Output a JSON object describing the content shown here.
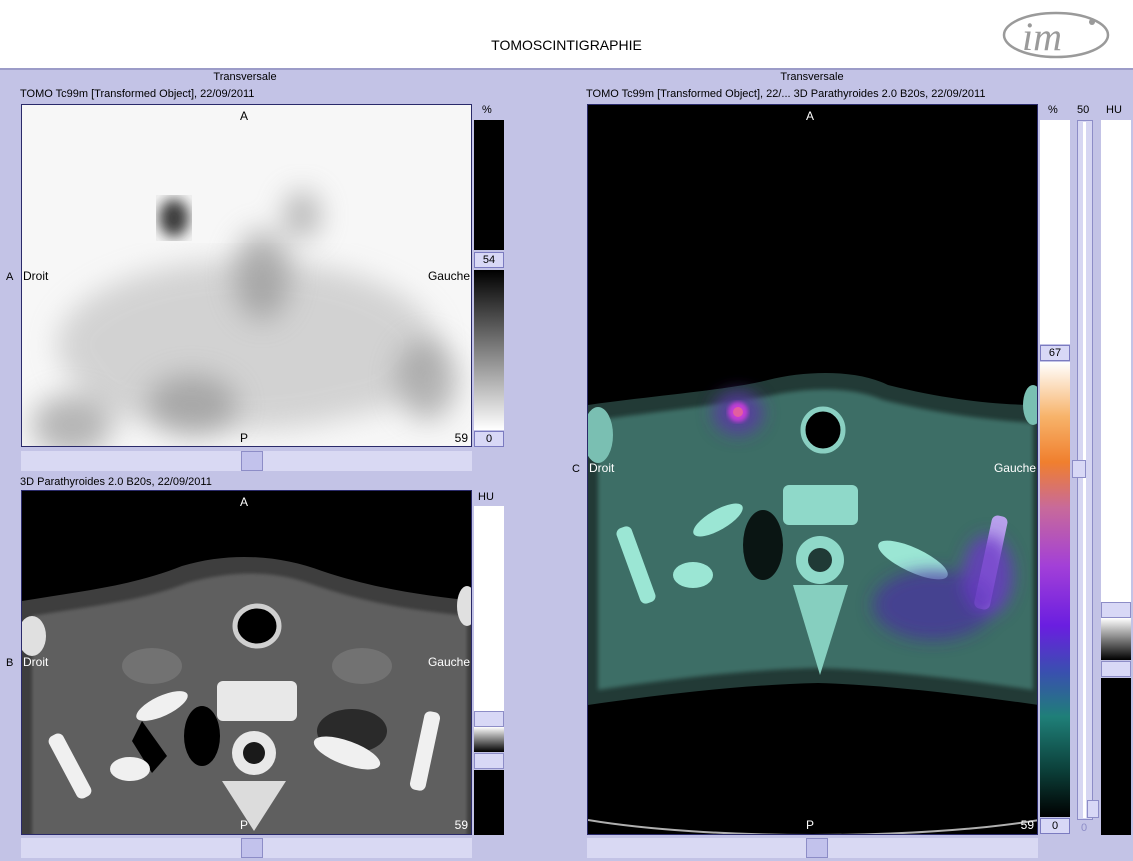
{
  "header": {
    "title": "TOMOSCINTIGRAPHIE",
    "logo_text": "im"
  },
  "panel_a": {
    "orientation": "Transversale",
    "series": "TOMO Tc99m [Transformed Object], 22/09/2011",
    "side_letter": "A",
    "top": "A",
    "bottom": "P",
    "left": "Droit",
    "right": "Gauche",
    "slice": "59",
    "scale_unit": "%",
    "scale_max": "54",
    "scale_min": "0"
  },
  "panel_b": {
    "series": "3D Parathyroides  2.0  B20s, 22/09/2011",
    "side_letter": "B",
    "top": "A",
    "bottom": "P",
    "left": "Droit",
    "right": "Gauche",
    "slice": "59",
    "scale_unit": "HU"
  },
  "panel_c": {
    "orientation": "Transversale",
    "series": "TOMO Tc99m [Transformed Object], 22/...  3D Parathyroides  2.0  B20s, 22/09/2011",
    "side_letter": "C",
    "top": "A",
    "bottom": "P",
    "left": "Droit",
    "right": "Gauche",
    "slice": "59",
    "scale_unit": "%",
    "scale_max": "67",
    "scale_min": "0",
    "blend_top": "50",
    "blend_bottom": "0",
    "ct_unit": "HU"
  }
}
